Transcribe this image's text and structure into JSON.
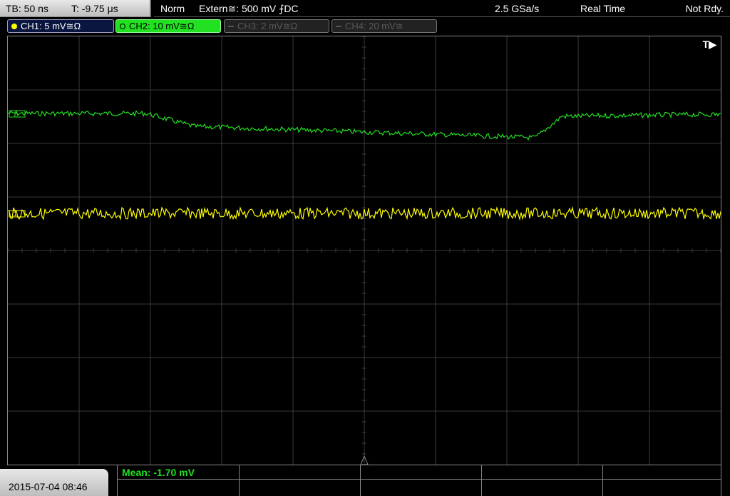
{
  "topbar": {
    "timebase": "TB: 50 ns",
    "trigger_time": "T: -9.75 μs",
    "mode": "Norm",
    "trigger_source": "Extern≅: 500 mV ⨍DC",
    "sample_rate": "2.5 GSa/s",
    "acq_mode": "Real Time",
    "status": "Not Rdy."
  },
  "channels": [
    {
      "label": "CH1: 5 mV≅Ω",
      "color": "#ffff00",
      "active": true
    },
    {
      "label": "CH2: 10 mV≅Ω",
      "color": "#22e022",
      "active": true
    },
    {
      "label": "CH3: 2 mV≅Ω",
      "color": "#555555",
      "active": false
    },
    {
      "label": "CH4: 20 mV≅",
      "color": "#555555",
      "active": false
    }
  ],
  "screen": {
    "trigger_marker": "T▶",
    "ch1_marker": "1",
    "ch2_marker": "2"
  },
  "bottom": {
    "datetime": "2015-07-04 08:46",
    "measurement": "Mean: -1.70 mV"
  }
}
